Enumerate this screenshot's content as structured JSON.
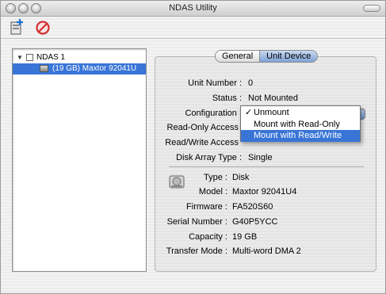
{
  "window": {
    "title": "NDAS Utility"
  },
  "toolbar": {
    "add_icon": "add-disk-icon",
    "remove_icon": "prohibit-icon"
  },
  "tree": {
    "items": [
      {
        "label": "NDAS 1",
        "expanded": true
      },
      {
        "label": "(19 GB) Maxtor 92041U",
        "selected": true
      }
    ]
  },
  "tabs": [
    {
      "label": "General",
      "active": false
    },
    {
      "label": "Unit Device",
      "active": true
    }
  ],
  "details": {
    "unit_number_label": "Unit Number :",
    "unit_number_value": "0",
    "status_label": "Status :",
    "status_value": "Not Mounted",
    "configuration_label": "Configuration :",
    "read_only_access_label": "Read-Only Access",
    "read_write_access_label": "Read/Write Access",
    "disk_array_type_label": "Disk Array Type :",
    "disk_array_type_value": "Single",
    "type_label": "Type :",
    "type_value": "Disk",
    "model_label": "Model :",
    "model_value": "Maxtor 92041U4",
    "firmware_label": "Firmware :",
    "firmware_value": "FA520S60",
    "serial_label": "Serial Number :",
    "serial_value": "G40P5YCC",
    "capacity_label": "Capacity :",
    "capacity_value": "19 GB",
    "transfer_label": "Transfer Mode :",
    "transfer_value": "Multi-word DMA 2"
  },
  "configuration_menu": {
    "options": [
      {
        "label": "Unmount",
        "checked": true
      },
      {
        "label": "Mount with Read-Only",
        "checked": false
      },
      {
        "label": "Mount with Read/Write",
        "highlighted": true
      }
    ],
    "check_glyph": "✓"
  },
  "colors": {
    "selection": "#3875d7"
  }
}
